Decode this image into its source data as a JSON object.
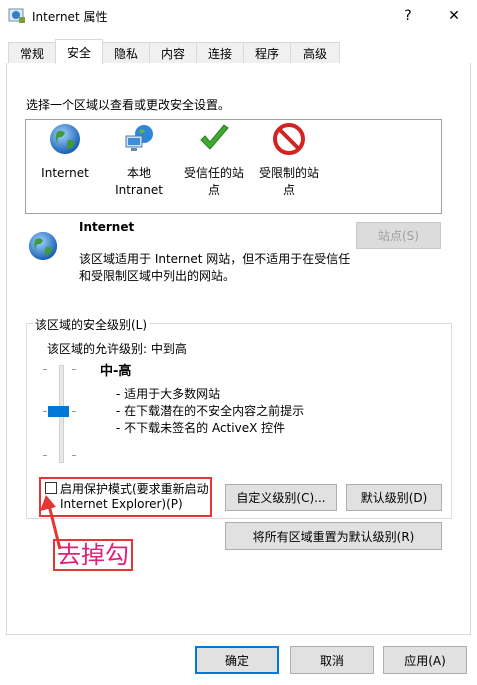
{
  "window": {
    "title": "Internet 属性",
    "help_label": "?",
    "close_label": "✕"
  },
  "tabs": [
    {
      "label": "常规"
    },
    {
      "label": "安全"
    },
    {
      "label": "隐私"
    },
    {
      "label": "内容"
    },
    {
      "label": "连接"
    },
    {
      "label": "程序"
    },
    {
      "label": "高级"
    }
  ],
  "security": {
    "zone_prompt": "选择一个区域以查看或更改安全设置。",
    "zones": [
      {
        "line1": "Internet",
        "line2": "",
        "icon": "globe-icon"
      },
      {
        "line1": "本地",
        "line2": "Intranet",
        "icon": "local-intranet-icon"
      },
      {
        "line1": "受信任的站",
        "line2": "点",
        "icon": "checkmark-icon"
      },
      {
        "line1": "受限制的站",
        "line2": "点",
        "icon": "restricted-icon"
      }
    ],
    "selected_zone": {
      "name": "Internet",
      "description_line1": "该区域适用于 Internet 网站，但不适用于在受信任",
      "description_line2": "和受限制区域中列出的网站。"
    },
    "sites_button": "站点(S)",
    "level_group_label": "该区域的安全级别(L)",
    "allowed_levels": "该区域的允许级别: 中到高",
    "level_name": "中-高",
    "level_bullets": [
      "- 适用于大多数网站",
      "- 在下载潜在的不安全内容之前提示",
      "- 不下载未签名的 ActiveX 控件"
    ],
    "protected_mode_line1": "启用保护模式(要求重新启动",
    "protected_mode_line2": "Internet Explorer)(P)",
    "protected_mode_checked": false,
    "custom_level_button": "自定义级别(C)...",
    "default_level_button": "默认级别(D)",
    "reset_all_button": "将所有区域重置为默认级别(R)"
  },
  "annotation": {
    "text": "去掉勾"
  },
  "footer": {
    "ok_button": "确定",
    "cancel_button": "取消",
    "apply_button": "应用(A)"
  },
  "colors": {
    "accent": "#0078d7",
    "annotation_red": "#e53535",
    "annotation_text": "#e0207a"
  }
}
